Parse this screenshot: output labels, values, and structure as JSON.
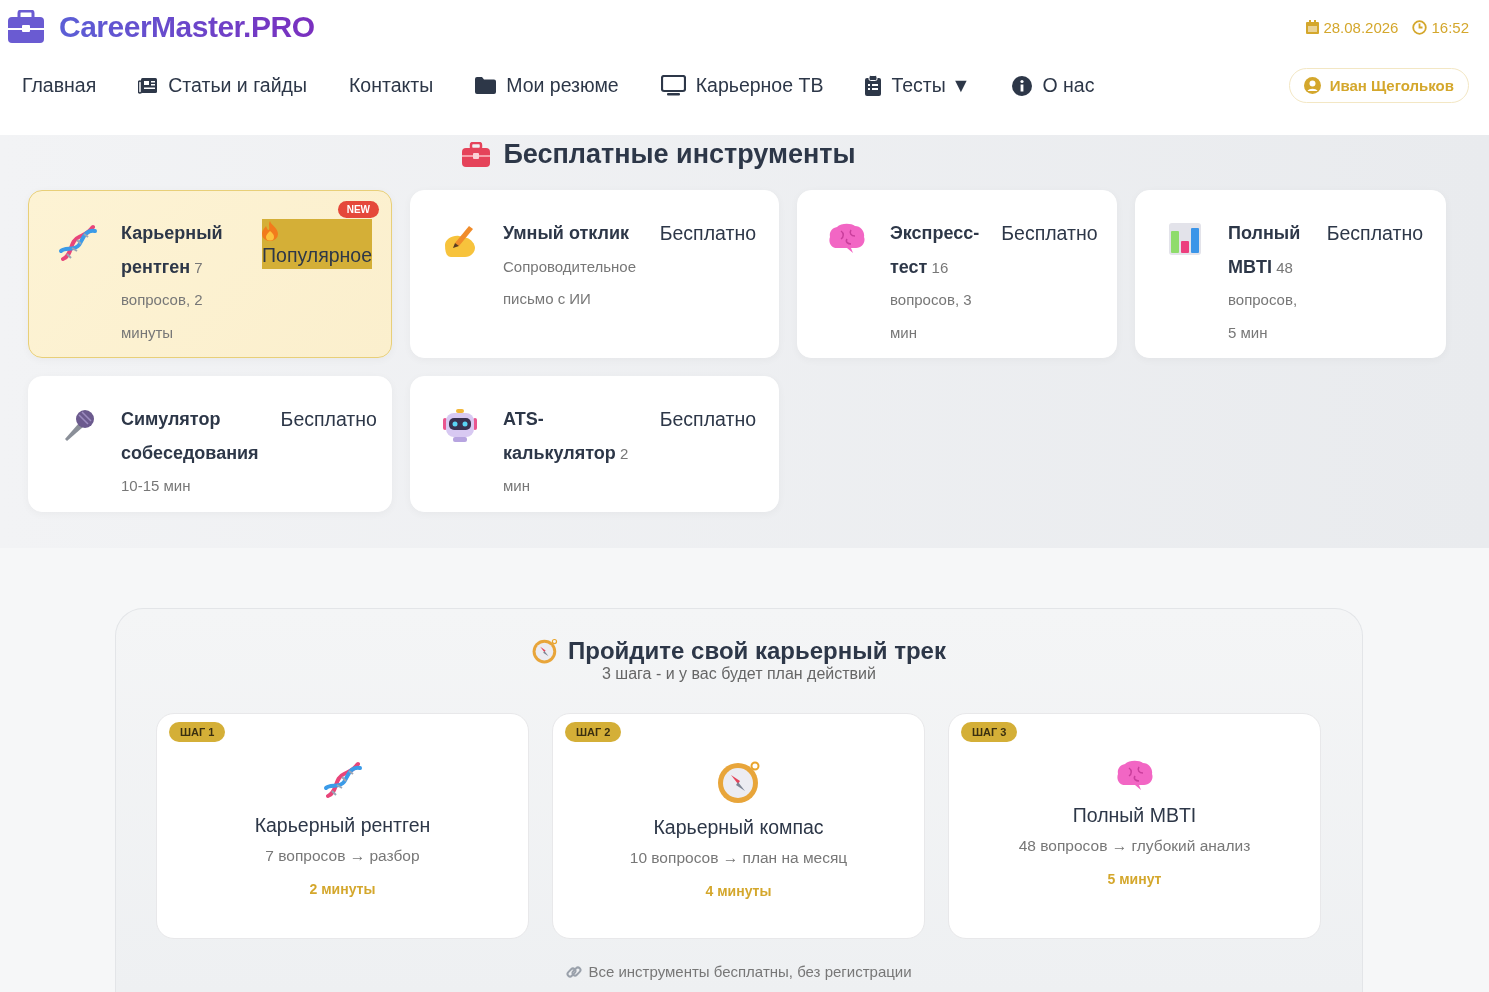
{
  "header": {
    "brand": "CareerMaster.PRO",
    "date": "28.08.2026",
    "time": "16:52",
    "user": "Иван Щегольков"
  },
  "nav": [
    {
      "label": "Главная"
    },
    {
      "label": "Статьи и гайды"
    },
    {
      "label": "Контакты"
    },
    {
      "label": "Мои резюме"
    },
    {
      "label": "Карьерное ТВ"
    },
    {
      "label": "Тесты",
      "caret": "▼"
    },
    {
      "label": "О нас"
    }
  ],
  "tools": {
    "title": "Бесплатные инструменты",
    "cards": [
      {
        "text": "**Карьерный рентген** 7 вопросов, 2 минуты",
        "badge": "Популярное",
        "kind": "popular",
        "featured": true,
        "ribbon": "NEW"
      },
      {
        "text": "**Умный отклик** Сопроводительное письмо с ИИ",
        "badge": "Бесплатно",
        "kind": "free",
        "featured": false
      },
      {
        "text": "**Экспресс-тест** 16 вопросов, 3 мин",
        "badge": "Бесплатно",
        "kind": "free",
        "featured": false
      },
      {
        "text": "**Полный MBTI** 48 вопросов, 5 мин",
        "badge": "Бесплатно",
        "kind": "free",
        "featured": false
      },
      {
        "text": "**Симулятор собеседования** 10-15 мин",
        "badge": "Бесплатно",
        "kind": "free",
        "featured": false
      },
      {
        "text": "**ATS-калькулятор** 2 мин",
        "badge": "Бесплатно",
        "kind": "free",
        "featured": false
      }
    ]
  },
  "track": {
    "title": "Пройдите свой карьерный трек",
    "subtitle": "3 шага - и у вас будет план действий",
    "steps": [
      {
        "step": "ШАГ 1",
        "title": "Карьерный рентген",
        "desc": "7 вопросов → разбор",
        "time": "2 минуты"
      },
      {
        "step": "ШАГ 2",
        "title": "Карьерный компас",
        "desc": "10 вопросов → план на месяц",
        "time": "4 минуты"
      },
      {
        "step": "ШАГ 3",
        "title": "Полный MBTI",
        "desc": "48 вопросов → глубокий анализ",
        "time": "5 минут"
      }
    ],
    "footer": "Все инструменты бесплатны, без регистрации"
  }
}
